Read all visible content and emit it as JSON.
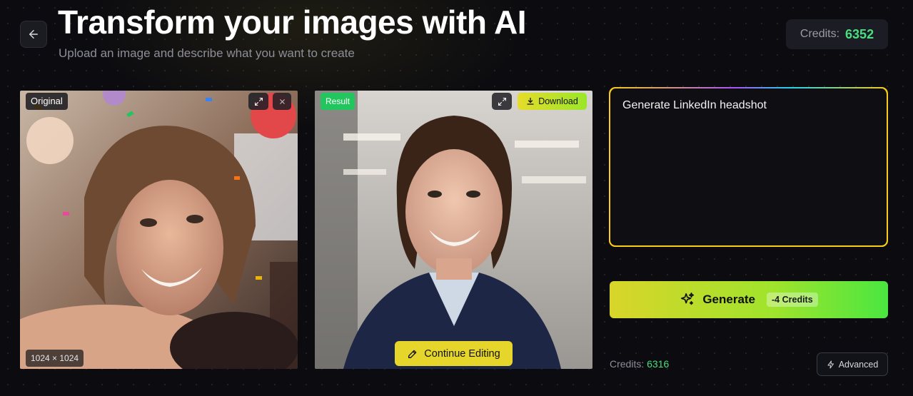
{
  "header": {
    "title": "Transform your images with AI",
    "subtitle": "Upload an image and describe what you want to create",
    "credits_label": "Credits:",
    "credits_value": "6352"
  },
  "original_panel": {
    "label": "Original",
    "dimensions": "1024 × 1024"
  },
  "result_panel": {
    "label": "Result",
    "download_label": "Download",
    "continue_label": "Continue Editing"
  },
  "prompt": {
    "value": "Generate LinkedIn headshot"
  },
  "generate": {
    "label": "Generate",
    "cost": "-4 Credits"
  },
  "footer": {
    "credits_label": "Credits:",
    "credits_value": "6316",
    "advanced_label": "Advanced"
  },
  "colors": {
    "accent_green": "#4ade80",
    "accent_yellow": "#e6d62c",
    "background": "#0b0b10"
  },
  "icons": [
    "arrow-left-icon",
    "expand-icon",
    "close-icon",
    "download-icon",
    "pencil-icon",
    "sparkles-icon",
    "bolt-icon"
  ]
}
